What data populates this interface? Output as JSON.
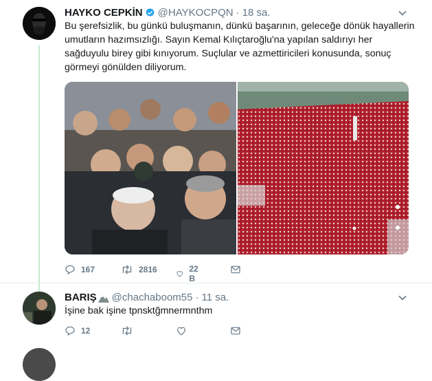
{
  "tweet1": {
    "name": "HAYKO CEPKİN",
    "handle": "@HAYKOCPQN",
    "dot": "·",
    "time": "18 sa.",
    "text": "Bu şerefsizlik, bu günkü buluşmanın, dünkü başarının, geleceğe dönük hayallerin umutların hazımsızlığı. Sayın Kemal Kılıçtaroğlu'na yapılan saldırıyı her sağduyulu birey gibi kınıyorum. Suçlular ve azmettiricileri konusunda, sonuç görmeyi gönülden diliyorum.",
    "replies": "167",
    "retweets": "2816",
    "likes": "22 B"
  },
  "tweet2": {
    "name": "BARIŞ",
    "handle": "@chachaboom55",
    "dot": "·",
    "time": "11 sa.",
    "text": "İşine bak işine tpnsktğmnermnthm",
    "replies": "12",
    "retweets": "",
    "likes": ""
  },
  "icons": {
    "reply": "reply-icon",
    "retweet": "retweet-icon",
    "like": "heart-icon",
    "message": "message-icon",
    "caret": "chevron-down-icon",
    "verified": "verified-badge-icon"
  },
  "colors": {
    "verified": "#1da1f2",
    "thread_line": "#c4e9cf",
    "secondary_text": "#657786"
  }
}
